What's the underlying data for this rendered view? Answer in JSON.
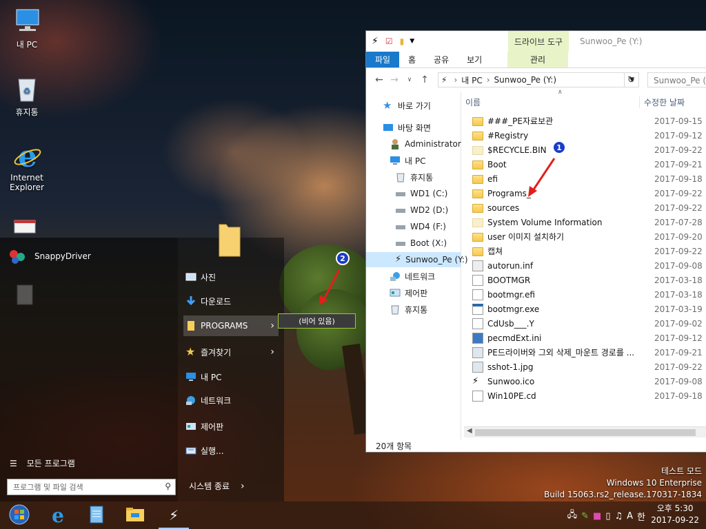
{
  "desktop": {
    "icons": [
      {
        "label": "내 PC",
        "icon": "computer-icon"
      },
      {
        "label": "휴지통",
        "icon": "recycle-bin-icon"
      },
      {
        "label": "Internet Explorer",
        "icon": "internet-explorer-icon"
      },
      {
        "label": "SnappyDriver",
        "icon": "snappydriver-icon"
      }
    ]
  },
  "start_menu": {
    "right_items": [
      {
        "label": "사진",
        "icon": "pictures-icon"
      },
      {
        "label": "다운로드",
        "icon": "download-icon"
      },
      {
        "label": "PROGRAMS",
        "icon": "folder-icon"
      },
      {
        "label": "즐겨찾기",
        "icon": "star-icon"
      },
      {
        "label": "내 PC",
        "icon": "computer-icon"
      },
      {
        "label": "네트워크",
        "icon": "network-icon"
      },
      {
        "label": "제어판",
        "icon": "control-panel-icon"
      },
      {
        "label": "실행...",
        "icon": "run-icon"
      }
    ],
    "all_programs": "모든 프로그램",
    "search_placeholder": "프로그램 및 파일 검색",
    "shutdown": "시스템 종료",
    "submenu_empty": "(비어 있음)"
  },
  "annotations": {
    "badge1": "1",
    "badge2": "2"
  },
  "explorer": {
    "context_header": "드라이브 도구",
    "window_title": "Sunwoo_Pe (Y:)",
    "tabs": [
      "파일",
      "홈",
      "공유",
      "보기"
    ],
    "context_tab": "관리",
    "breadcrumb": [
      "내 PC",
      "Sunwoo_Pe (Y:)"
    ],
    "search_placeholder": "Sunwoo_Pe (Y:) 검색",
    "nav": [
      {
        "label": "바로 가기",
        "icon": "star-icon"
      },
      {
        "label": "바탕 화면",
        "icon": "desktop-icon"
      },
      {
        "label": "Administrator",
        "icon": "user-icon"
      },
      {
        "label": "내 PC",
        "icon": "computer-icon"
      },
      {
        "label": "휴지통",
        "icon": "recycle-bin-icon"
      },
      {
        "label": "WD1 (C:)",
        "icon": "drive-icon"
      },
      {
        "label": "WD2 (D:)",
        "icon": "drive-icon"
      },
      {
        "label": "WD4 (F:)",
        "icon": "drive-icon"
      },
      {
        "label": "Boot (X:)",
        "icon": "drive-icon"
      },
      {
        "label": "Sunwoo_Pe (Y:)",
        "icon": "sunwoo-drive-icon"
      },
      {
        "label": "네트워크",
        "icon": "network-icon"
      },
      {
        "label": "제어판",
        "icon": "control-panel-icon"
      },
      {
        "label": "휴지통",
        "icon": "recycle-bin-icon"
      }
    ],
    "columns": {
      "name": "이름",
      "modified": "수정한 날짜"
    },
    "files": [
      {
        "name": "###_PE자료보관",
        "date": "2017-09-15",
        "kind": "folder"
      },
      {
        "name": "#Registry",
        "date": "2017-09-12",
        "kind": "folder"
      },
      {
        "name": "$RECYCLE.BIN",
        "date": "2017-09-22",
        "kind": "system-folder"
      },
      {
        "name": "Boot",
        "date": "2017-09-21",
        "kind": "folder"
      },
      {
        "name": "efi",
        "date": "2017-09-18",
        "kind": "folder"
      },
      {
        "name": "Programs_",
        "date": "2017-09-22",
        "kind": "folder"
      },
      {
        "name": "sources",
        "date": "2017-09-22",
        "kind": "folder"
      },
      {
        "name": "System Volume Information",
        "date": "2017-07-28",
        "kind": "system-folder"
      },
      {
        "name": "user 이미지 설치하기",
        "date": "2017-09-20",
        "kind": "folder"
      },
      {
        "name": "캡쳐",
        "date": "2017-09-22",
        "kind": "folder"
      },
      {
        "name": "autorun.inf",
        "date": "2017-09-08",
        "kind": "settings"
      },
      {
        "name": "BOOTMGR",
        "date": "2017-03-18",
        "kind": "file"
      },
      {
        "name": "bootmgr.efi",
        "date": "2017-03-18",
        "kind": "file"
      },
      {
        "name": "bootmgr.exe",
        "date": "2017-03-19",
        "kind": "exe"
      },
      {
        "name": "CdUsb___.Y",
        "date": "2017-09-02",
        "kind": "file"
      },
      {
        "name": "pecmdExt.ini",
        "date": "2017-09-12",
        "kind": "ini"
      },
      {
        "name": "PE드라이버와 그외 삭제_마운트 경로를 ...",
        "date": "2017-09-21",
        "kind": "image"
      },
      {
        "name": "sshot-1.jpg",
        "date": "2017-09-22",
        "kind": "image"
      },
      {
        "name": "Sunwoo.ico",
        "date": "2017-09-08",
        "kind": "ico"
      },
      {
        "name": "Win10PE.cd",
        "date": "2017-09-18",
        "kind": "file"
      }
    ],
    "status": "20개 항목"
  },
  "watermark": [
    "테스트 모드",
    "Windows 10 Enterprise",
    "Build 15063.rs2_release.170317-1834"
  ],
  "taskbar": {
    "apps": [
      "start-orb-icon",
      "internet-explorer-icon",
      "notepad-icon",
      "file-explorer-icon",
      "sunwoo-icon"
    ],
    "ime": "A",
    "ime_lang": "한",
    "time": "오후 5:30",
    "date": "2017-09-22"
  }
}
